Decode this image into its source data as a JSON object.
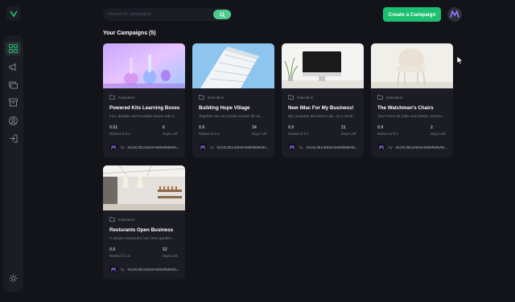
{
  "search": {
    "placeholder": "Search for campaigns"
  },
  "header": {
    "create_label": "Create a Campaign"
  },
  "colors": {
    "background": "#13131a",
    "panel": "#1c1c24",
    "accent": "#1dc071",
    "muted": "#808191",
    "brand_purple": "#8c6dfd"
  },
  "sidebar": {
    "items": [
      {
        "icon": "dashboard-icon",
        "active": true
      },
      {
        "icon": "campaign-megaphone-icon",
        "active": false
      },
      {
        "icon": "payment-icon",
        "active": false
      },
      {
        "icon": "withdraw-icon",
        "active": false
      },
      {
        "icon": "profile-icon",
        "active": false
      },
      {
        "icon": "logout-icon",
        "active": false
      },
      {
        "icon": "theme-sun-icon",
        "active": false
      }
    ]
  },
  "section": {
    "title": "Your Campaigns (5)"
  },
  "campaigns": [
    {
      "category": "Education",
      "title": "Powered Kits Learning Boxes",
      "description": "Fun, durable and reusable boxes with e...",
      "raised": "0.01",
      "raised_label": "Raised of 0.1",
      "days": "6",
      "days_label": "Days Left",
      "owner_prefix": "by",
      "owner": "0x24Cd51cE820A8656f589281..."
    },
    {
      "category": "Education",
      "title": "Building Hope Village",
      "description": "Together we can create access for ov...",
      "raised": "0.0",
      "raised_label": "Raised of 1.0",
      "days": "34",
      "days_label": "Days Left",
      "owner_prefix": "by",
      "owner": "0x24Cd51cE820A8656f589281..."
    },
    {
      "category": "Education",
      "title": "New iMac For My Business!",
      "description": "My computer decided to die, As a result...",
      "raised": "0.0",
      "raised_label": "Raised of 0.7",
      "days": "21",
      "days_label": "Days Left",
      "owner_prefix": "by",
      "owner": "0x24Cd51cE820A8656f589281..."
    },
    {
      "category": "Education",
      "title": "The Watchman's Chairs",
      "description": "Your home for indie and classic cinema...",
      "raised": "0.0",
      "raised_label": "Raised of 0.1",
      "days": "2",
      "days_label": "Days Left",
      "owner_prefix": "by",
      "owner": "0x24Cd51cE820A8656f589281..."
    },
    {
      "category": "Education",
      "title": "Resturants Open Business",
      "description": "A unique restaurant, bar, beer garden,...",
      "raised": "0.0",
      "raised_label": "Raised of 1.5",
      "days": "52",
      "days_label": "Days Left",
      "owner_prefix": "by",
      "owner": "0x24Cd51cE820A8656f589281..."
    }
  ]
}
